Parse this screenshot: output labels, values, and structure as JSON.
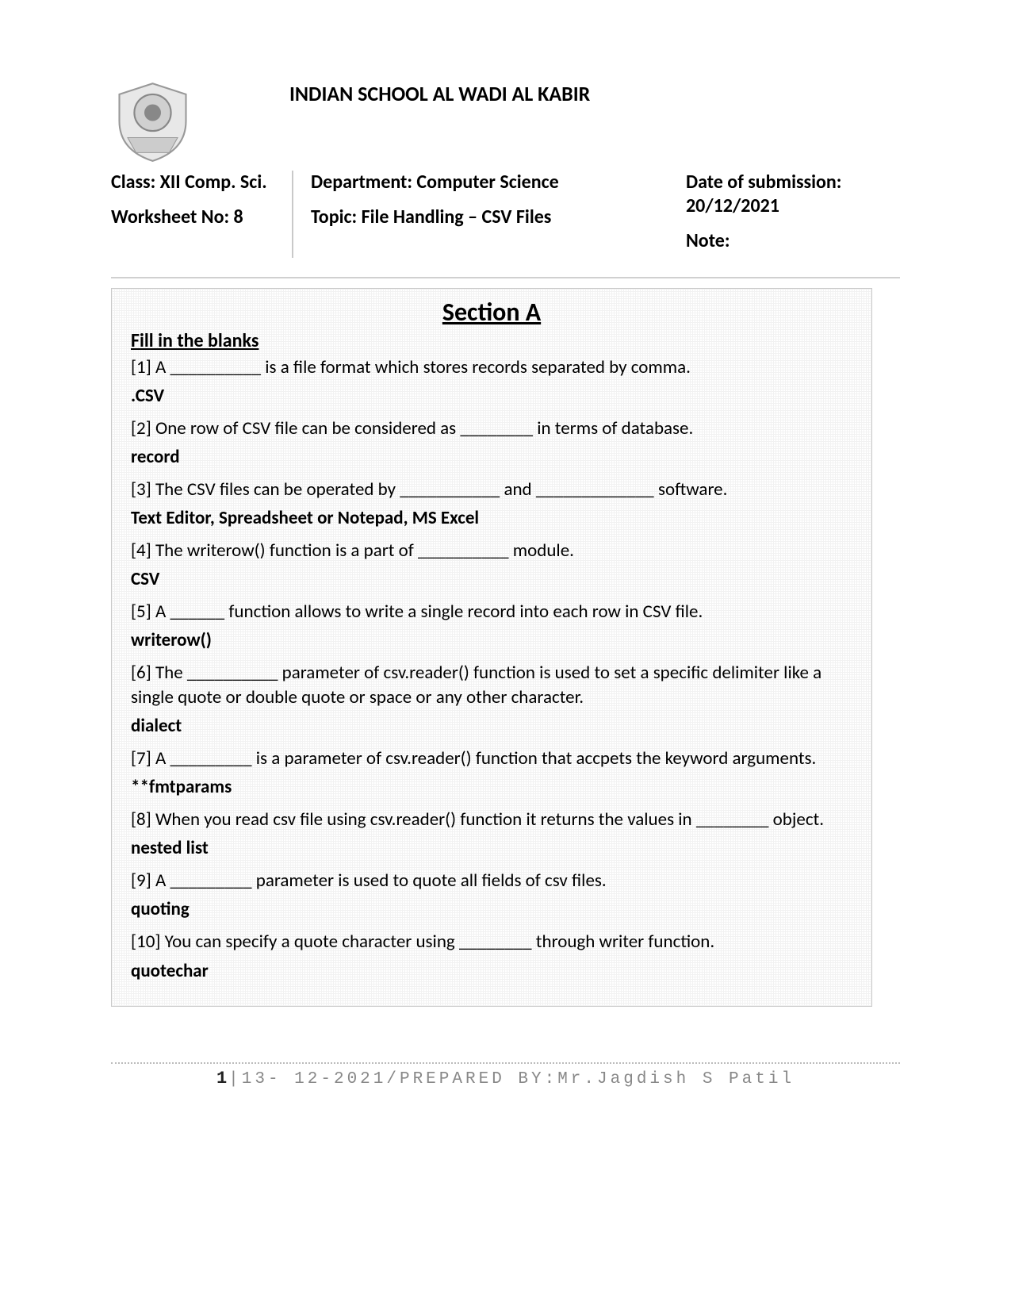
{
  "header": {
    "school_name": "INDIAN SCHOOL AL WADI AL KABIR",
    "class_line1": "Class: XII Comp. Sci.",
    "class_line2": " Worksheet No: 8",
    "dept": "Department: Computer Science",
    "topic": "Topic: File Handling – CSV Files",
    "date": "Date of submission: 20/12/2021",
    "note": "Note:"
  },
  "section": {
    "title": "Section A",
    "subtitle": "Fill in the blanks",
    "items": [
      {
        "q": "[1] A __________ is a file format which stores records separated by comma.",
        "a": ".CSV"
      },
      {
        "q": "[2] One row of CSV file can be considered as ________ in terms of database.",
        "a": "record"
      },
      {
        "q": "[3] The CSV files can be operated by ___________ and _____________ software.",
        "a": "Text Editor, Spreadsheet or Notepad, MS Excel"
      },
      {
        "q": "[4] The writerow() function is a part of __________ module.",
        "a": "CSV"
      },
      {
        "q": "[5] A ______ function allows to write a single record into each row in CSV file.",
        "a": "writerow()"
      },
      {
        "q": "[6] The __________ parameter of csv.reader() function is used to set a specific delimiter like a single quote or double quote or space or any other character.",
        "a": "dialect"
      },
      {
        "q": "[7] A _________ is a parameter of csv.reader() function that accpets the keyword arguments.",
        "a": "**fmtparams"
      },
      {
        "q": "[8] When you read csv file using csv.reader() function it returns the values in ________ object.",
        "a": "nested list"
      },
      {
        "q": "[9] A _________ parameter is used to quote all fields of csv files.",
        "a": "quoting"
      },
      {
        "q": "[10] You can specify a quote character using ________ through writer function.",
        "a": "quotechar"
      }
    ]
  },
  "footer": {
    "page_num": "1",
    "text": "|13- 12-2021/PREPARED BY:Mr.Jagdish S Patil"
  }
}
